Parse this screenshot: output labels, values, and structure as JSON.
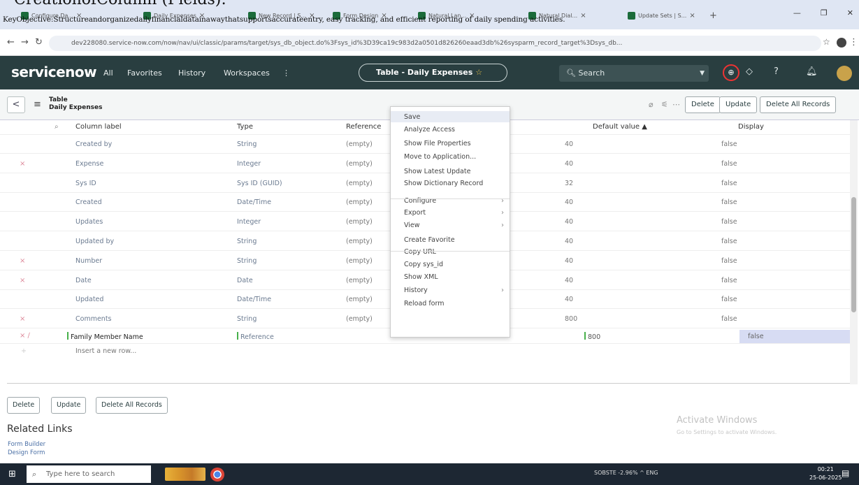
{
  "overlay": {
    "title": "CreationofColumn (Fields):",
    "objective": "KeyObjective:Structureandorganizedailyfinancialdatainawaythatsupportsaccurateentry, easy tracking, and efficient reporting of daily spending activities."
  },
  "browser": {
    "tabs": [
      "Configure Da...",
      "Daily Expenses",
      "New Record | S...",
      "Form Design",
      "Natural Lan...",
      "Natural Dial...",
      "Update Sets | S..."
    ],
    "url": "dev228080.service-now.com/now/nav/ui/classic/params/target/sys_db_object.do%3Fsys_id%3D39ca19c983d2a0501d826260eaad3db%26sysparm_record_target%3Dsys_db...",
    "new_tab": "+",
    "minimize": "—",
    "maximize": "❐",
    "close": "✕"
  },
  "header": {
    "logo": "servicenow",
    "nav": [
      "All",
      "Favorites",
      "History",
      "Workspaces"
    ],
    "more": "⋮",
    "context_pill": "Table - Daily Expenses",
    "search_placeholder": "Search",
    "icons": [
      "scope-icon",
      "chat-icon",
      "help-icon",
      "bell-icon",
      "avatar"
    ]
  },
  "form": {
    "back": "<",
    "menu": "≡",
    "type": "Table",
    "name": "Daily Expenses",
    "buttons": {
      "delete": "Delete",
      "update": "Update",
      "delete_all": "Delete All Records"
    }
  },
  "table": {
    "columns": {
      "label": "Column label",
      "type": "Type",
      "reference": "Reference",
      "default_value": "Default value ▲",
      "display": "Display"
    },
    "rows": [
      {
        "x": "",
        "label": "Created by",
        "type": "String",
        "reference": "(empty)",
        "default_value": "40",
        "display": "false"
      },
      {
        "x": "×",
        "label": "Expense",
        "type": "Integer",
        "reference": "(empty)",
        "default_value": "40",
        "display": "false"
      },
      {
        "x": "",
        "label": "Sys ID",
        "type": "Sys ID (GUID)",
        "reference": "(empty)",
        "default_value": "32",
        "display": "false"
      },
      {
        "x": "",
        "label": "Created",
        "type": "Date/Time",
        "reference": "(empty)",
        "default_value": "40",
        "display": "false"
      },
      {
        "x": "",
        "label": "Updates",
        "type": "Integer",
        "reference": "(empty)",
        "default_value": "40",
        "display": "false"
      },
      {
        "x": "",
        "label": "Updated by",
        "type": "String",
        "reference": "(empty)",
        "default_value": "40",
        "display": "false"
      },
      {
        "x": "×",
        "label": "Number",
        "type": "String",
        "reference": "(empty)",
        "default_value": "40",
        "display": "false"
      },
      {
        "x": "×",
        "label": "Date",
        "type": "Date",
        "reference": "(empty)",
        "default_value": "40",
        "display": "false"
      },
      {
        "x": "",
        "label": "Updated",
        "type": "Date/Time",
        "reference": "(empty)",
        "default_value": "40",
        "display": "false"
      },
      {
        "x": "×",
        "label": "Comments",
        "type": "String",
        "reference": "(empty)",
        "default_value": "800",
        "display": "false"
      }
    ],
    "new_row": {
      "label": "Family Member Name",
      "type": "Reference",
      "default_value": "800",
      "display": "false"
    },
    "insert_row": "Insert a new row..."
  },
  "context_menu": {
    "items": [
      {
        "label": "Save"
      },
      {
        "label": "Analyze Access"
      },
      {
        "label": "Show File Properties"
      },
      {
        "label": "Move to Application..."
      },
      {
        "label": "Show Latest Update"
      },
      {
        "label": "Show Dictionary Record"
      },
      {
        "label": "Configure",
        "sub": "›"
      },
      {
        "label": "Export",
        "sub": "›"
      },
      {
        "label": "View",
        "sub": "›"
      },
      {
        "label": "Create Favorite"
      },
      {
        "label": "Copy URL"
      },
      {
        "label": "Copy sys_id"
      },
      {
        "label": "Show XML"
      },
      {
        "label": "History",
        "sub": "›"
      },
      {
        "label": "Reload form"
      }
    ]
  },
  "bottom": {
    "buttons": {
      "delete": "Delete",
      "update": "Update",
      "delete_all": "Delete All Records"
    },
    "related_links_title": "Related Links",
    "links": [
      "Form Builder",
      "Design Form"
    ],
    "activate_title": "Activate Windows",
    "activate_sub": "Go to Settings to activate Windows."
  },
  "taskbar": {
    "search_placeholder": "Type here to search",
    "tray": "SOBSTE  -2.96%   ^  ENG",
    "time": "00:21",
    "date": "25-06-2025"
  },
  "colors": {
    "header_bg": "#293e40",
    "accent_green": "#47b04b",
    "delete_x": "#dd8899",
    "selected_display": "#d7dcf3"
  }
}
